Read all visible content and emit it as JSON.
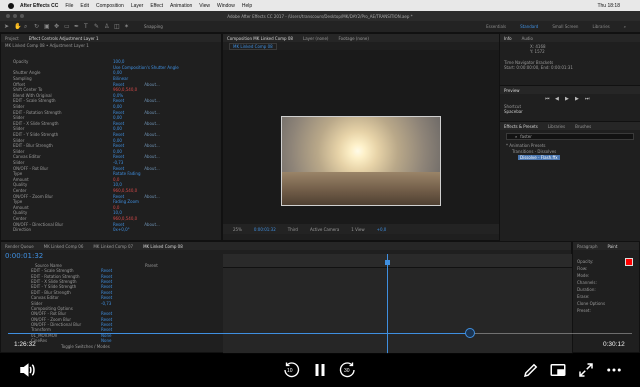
{
  "menubar": {
    "app_name": "After Effects CC",
    "items": [
      "File",
      "Edit",
      "Composition",
      "Layer",
      "Effect",
      "Animation",
      "View",
      "Window",
      "Help"
    ],
    "clock": "Thu 18:18"
  },
  "title_bar": {
    "text": "Adobe After Effects CC 2017 - /Users/transcours/Desktop/MK/DAY2/Pro_AE/TRANSITION.aep *"
  },
  "toolbar": {
    "snapping": "Snapping",
    "workspaces": [
      {
        "label": "Essentials",
        "active": false
      },
      {
        "label": "Standard",
        "active": true
      },
      {
        "label": "Small Screen",
        "active": false
      },
      {
        "label": "Libraries",
        "active": false
      }
    ]
  },
  "effect_controls": {
    "tab_project": "Project",
    "tab_label": "Effect Controls Adjustment Layer 1",
    "header": "MK Linked Comp 08 • Adjustment Layer 1",
    "rows": [
      {
        "name": "Opacity",
        "value": "100,0",
        "about": ""
      },
      {
        "name": "",
        "value": "Use Composition's Shutter Angle",
        "about": ""
      },
      {
        "name": "Shutter Angle",
        "value": "0,00",
        "about": ""
      },
      {
        "name": "Sampling",
        "value": "Bilinear",
        "about": ""
      },
      {
        "name": "Offset",
        "value": "Reset",
        "about": "About..."
      },
      {
        "name": "Shift Center To",
        "value": "960,0,540,0",
        "red": true,
        "about": ""
      },
      {
        "name": "Blend With Original",
        "value": "0,0%",
        "about": ""
      },
      {
        "name": "EDIT - Scale Strength",
        "value": "Reset",
        "about": "About..."
      },
      {
        "name": "Slider",
        "value": "0,00",
        "about": ""
      },
      {
        "name": "EDIT - Rotation Strength",
        "value": "Reset",
        "about": "About..."
      },
      {
        "name": "Slider",
        "value": "0,00",
        "about": ""
      },
      {
        "name": "EDIT - X Slide Strength",
        "value": "Reset",
        "about": "About..."
      },
      {
        "name": "Slider",
        "value": "0,00",
        "about": ""
      },
      {
        "name": "EDIT - Y Slide Strength",
        "value": "Reset",
        "about": "About..."
      },
      {
        "name": "Slider",
        "value": "0,00",
        "about": ""
      },
      {
        "name": "EDIT - Blur Strength",
        "value": "Reset",
        "about": "About..."
      },
      {
        "name": "Slider",
        "value": "0,00",
        "about": ""
      },
      {
        "name": "Canvas Editor",
        "value": "Reset",
        "about": "About..."
      },
      {
        "name": "Slider",
        "value": "-0,73",
        "about": ""
      },
      {
        "name": "ON/OFF - Rot Blur",
        "value": "Reset",
        "about": "About..."
      },
      {
        "name": "Type",
        "value": "Rotate Fading",
        "about": ""
      },
      {
        "name": "Amount",
        "value": "0,0",
        "red": true,
        "about": ""
      },
      {
        "name": "Quality",
        "value": "10,0",
        "about": ""
      },
      {
        "name": "Center",
        "value": "960,0,540,0",
        "red": true,
        "about": ""
      },
      {
        "name": "ON/OFF - Zoom Blur",
        "value": "Reset",
        "about": "About..."
      },
      {
        "name": "Type",
        "value": "Fading Zoom",
        "about": ""
      },
      {
        "name": "Amount",
        "value": "0,0",
        "red": true,
        "about": ""
      },
      {
        "name": "Quality",
        "value": "10,0",
        "about": ""
      },
      {
        "name": "Center",
        "value": "960,0,540,0",
        "red": true,
        "about": ""
      },
      {
        "name": "ON/OFF - Directional Blur",
        "value": "Reset",
        "about": "About..."
      },
      {
        "name": "Direction",
        "value": "0x+0,0°",
        "about": ""
      }
    ]
  },
  "comp_viewer": {
    "tabs": [
      "Composition MK Linked Comp 08",
      "Layer (none)",
      "Footage (none)"
    ],
    "sub_tab": "MK Linked Comp 08",
    "controls": [
      "25%",
      "0:00:01:32",
      "Third",
      "Active Camera",
      "1 View",
      "+0,0"
    ]
  },
  "info_panel": {
    "tabs": [
      "Info",
      "Audio"
    ],
    "coords": [
      "X: 4168",
      "Y: 1572"
    ],
    "lines": [
      "Time Navigator Brackets",
      "Start: 0:00:00:00, End: 0:00:01:31"
    ]
  },
  "preview_panel": {
    "title": "Preview",
    "shortcut_label": "Shortcut",
    "shortcut_value": "Spacebar"
  },
  "effects_presets": {
    "tabs": [
      "Effects & Presets",
      "Libraries",
      "Brushes"
    ],
    "search_value": "faster",
    "tree": [
      "* Animation Presets",
      "Transitions - Dissolves",
      "Dissolve - Flash.ffx"
    ]
  },
  "timeline": {
    "tabs": [
      "Render Queue",
      "MK Linked Comp 06",
      "MK Linked Comp 07",
      "MK Linked Comp 08"
    ],
    "timecode": "0:00:01:32",
    "col_source": "Source Name",
    "col_parent": "Parent",
    "rows": [
      {
        "name": "EDIT - Scale Strength",
        "value": "Reset"
      },
      {
        "name": "EDIT - Rotation Strength",
        "value": "Reset"
      },
      {
        "name": "EDIT - X Slide Strength",
        "value": "Reset"
      },
      {
        "name": "EDIT - Y Slide Strength",
        "value": "Reset"
      },
      {
        "name": "EDIT - Blur Strength",
        "value": "Reset"
      },
      {
        "name": "Canvas Editor",
        "value": "Reset"
      },
      {
        "name": "Slider",
        "value": "-0,73"
      },
      {
        "name": "Compositing Options",
        "value": ""
      },
      {
        "name": "ON/OFF - Rot Blur",
        "value": "Reset"
      },
      {
        "name": "ON/OFF - Zoom Blur",
        "value": "Reset"
      },
      {
        "name": "ON/OFF - Directional Blur",
        "value": "Reset"
      },
      {
        "name": "Transform",
        "value": "Reset"
      },
      {
        "name": "01_MOV.MOV",
        "value": "None"
      },
      {
        "name": "CineRes",
        "value": "None"
      }
    ],
    "toggle_label": "Toggle Switches / Modes"
  },
  "paragraph_panel": {
    "tabs": [
      "Paragraph",
      "Paint"
    ],
    "lines": [
      "Opacity:",
      "Flow:",
      "Mode:",
      "Channels:",
      "Duration:",
      "Erase:",
      "Clone Options",
      "Preset:"
    ],
    "swatch_color": "#ff0000"
  },
  "player": {
    "current_time": "1:26:32",
    "remaining_time": "0:30:12",
    "skip_back_seconds": "10",
    "skip_forward_seconds": "30",
    "progress": 0.74,
    "accent": "#3f8fe0"
  }
}
